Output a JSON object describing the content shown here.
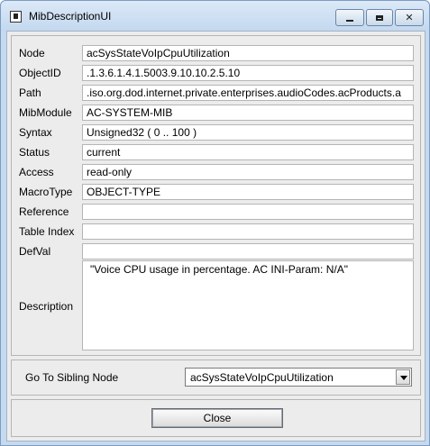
{
  "window": {
    "title": "MibDescriptionUI",
    "buttons": {
      "minimize": "minimize-icon",
      "maximize": "maximize-icon",
      "close": "close-icon",
      "close_glyph": "✕"
    }
  },
  "fields": [
    {
      "label": "Node",
      "value": "acSysStateVoIpCpuUtilization"
    },
    {
      "label": "ObjectID",
      "value": ".1.3.6.1.4.1.5003.9.10.10.2.5.10"
    },
    {
      "label": "Path",
      "value": ".iso.org.dod.internet.private.enterprises.audioCodes.acProducts.a"
    },
    {
      "label": "MibModule",
      "value": "AC-SYSTEM-MIB"
    },
    {
      "label": "Syntax",
      "value": "Unsigned32 ( 0 .. 100 )"
    },
    {
      "label": "Status",
      "value": "current"
    },
    {
      "label": "Access",
      "value": "read-only"
    },
    {
      "label": "MacroType",
      "value": "OBJECT-TYPE"
    },
    {
      "label": "Reference",
      "value": ""
    },
    {
      "label": "Table Index",
      "value": ""
    },
    {
      "label": "DefVal",
      "value": ""
    }
  ],
  "description": {
    "label": "Description",
    "value": "\"Voice CPU usage in percentage. AC INI-Param: N/A\""
  },
  "sibling": {
    "label": "Go To Sibling Node",
    "selected": "acSysStateVoIpCpuUtilization"
  },
  "actions": {
    "close_label": "Close"
  }
}
